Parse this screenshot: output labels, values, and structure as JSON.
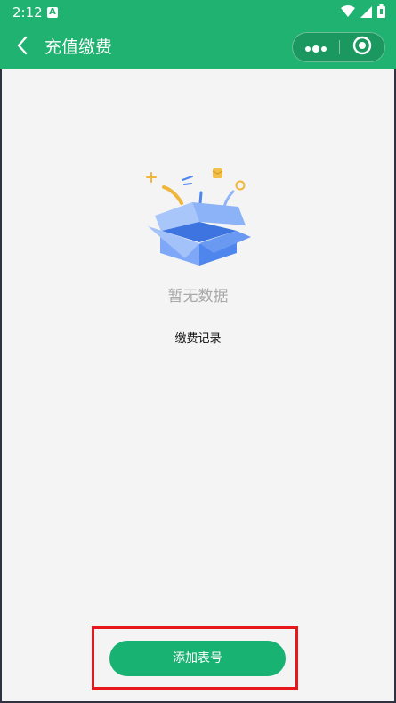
{
  "status_bar": {
    "time": "2:12",
    "notification_badge": "A"
  },
  "header": {
    "title": "充值缴费",
    "back_icon": "chevron-left-icon",
    "more_icon": "more-dots-icon",
    "close_icon": "target-circle-icon"
  },
  "empty_state": {
    "illustration": "open-box-icon",
    "text": "暂无数据"
  },
  "section": {
    "label": "缴费记录"
  },
  "actions": {
    "add_meter_label": "添加表号"
  },
  "colors": {
    "brand_green": "#20b270",
    "button_green": "#18b272",
    "highlight_red": "#e8171c",
    "box_blue": "#4f86ee"
  }
}
